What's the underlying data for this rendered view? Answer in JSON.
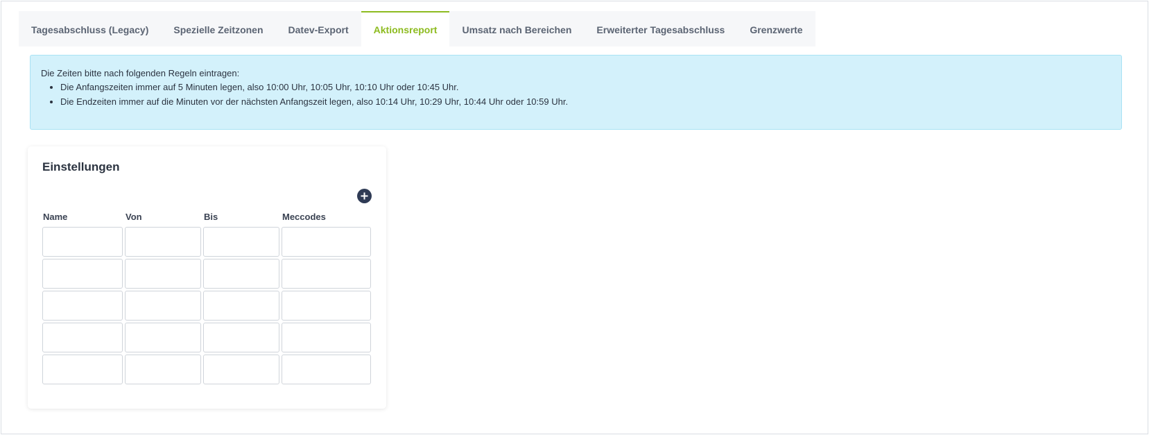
{
  "tabs": [
    {
      "label": "Tagesabschluss (Legacy)",
      "active": false
    },
    {
      "label": "Spezielle Zeitzonen",
      "active": false
    },
    {
      "label": "Datev-Export",
      "active": false
    },
    {
      "label": "Aktionsreport",
      "active": true
    },
    {
      "label": "Umsatz nach Bereichen",
      "active": false
    },
    {
      "label": "Erweiterter Tagesabschluss",
      "active": false
    },
    {
      "label": "Grenzwerte",
      "active": false
    }
  ],
  "info": {
    "intro": "Die Zeiten bitte nach folgenden Regeln eintragen:",
    "rules": [
      "Die Anfangszeiten immer auf 5 Minuten legen, also 10:00 Uhr, 10:05 Uhr, 10:10 Uhr oder 10:45 Uhr.",
      "Die Endzeiten immer auf die Minuten vor der nächsten Anfangszeit legen, also 10:14 Uhr, 10:29 Uhr, 10:44 Uhr oder 10:59 Uhr."
    ]
  },
  "settings": {
    "title": "Einstellungen",
    "add_icon": "plus-circle-icon",
    "columns": [
      "Name",
      "Von",
      "Bis",
      "Meccodes"
    ],
    "rows": [
      [
        "",
        "",
        "",
        ""
      ],
      [
        "",
        "",
        "",
        ""
      ],
      [
        "",
        "",
        "",
        ""
      ],
      [
        "",
        "",
        "",
        ""
      ],
      [
        "",
        "",
        "",
        ""
      ]
    ]
  },
  "colors": {
    "accent": "#8dbb1f",
    "info_bg": "#d3f1fb",
    "info_border": "#a9e2f4",
    "add_button": "#2f3b55"
  }
}
